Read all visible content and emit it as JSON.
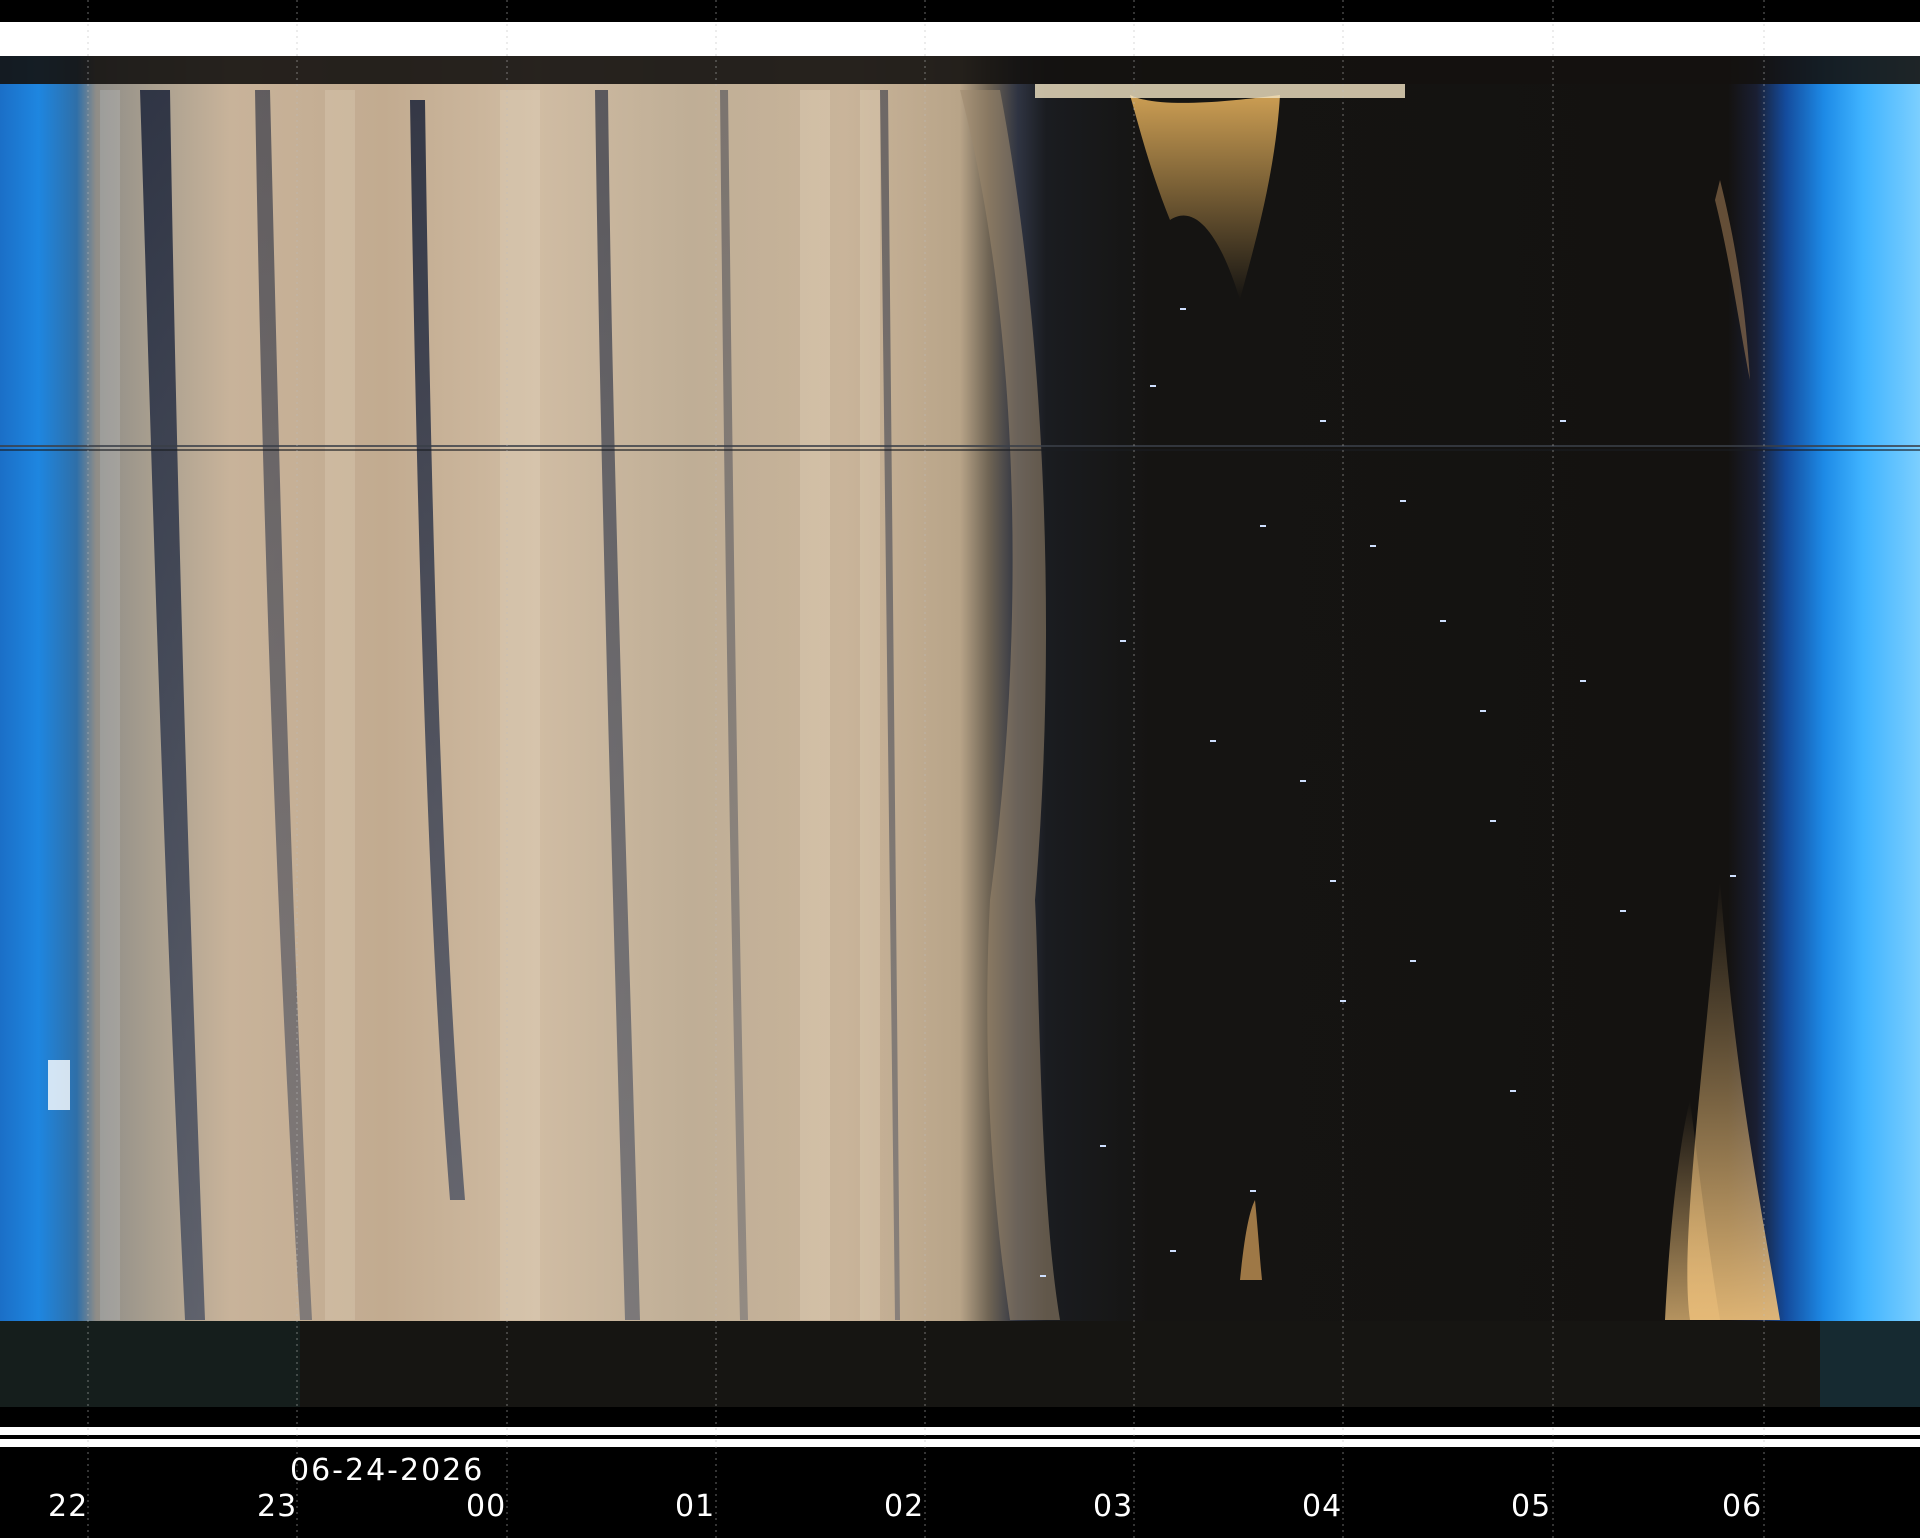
{
  "image": {
    "kind": "keogram",
    "description_tags": [
      "blue-twilight",
      "tan-auroral-bands",
      "starfield-night"
    ]
  },
  "axis": {
    "date": "06-24-2026",
    "hours": [
      "22",
      "23",
      "00",
      "01",
      "02",
      "03",
      "04",
      "05",
      "06"
    ]
  },
  "colors": {
    "background": "#000000",
    "twilight_blue": "#1b86e0",
    "sky_blue": "#3fb3ff",
    "tan_band": "#c9a982",
    "dark_sky": "#161411",
    "label": "#ffffff",
    "gridline": "#bdbdbd"
  }
}
